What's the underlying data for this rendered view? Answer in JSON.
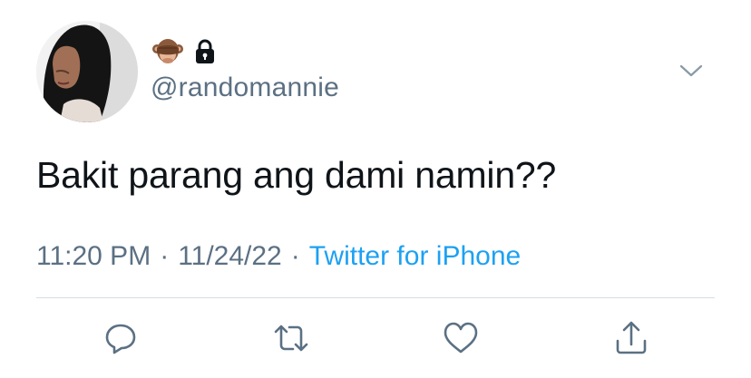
{
  "user": {
    "handle": "@randomannie",
    "name_emoji_icon": "see-no-evil-monkey-icon",
    "protected_icon": "lock-icon"
  },
  "tweet": {
    "text": "Bakit parang ang dami namin??",
    "time": "11:20 PM",
    "date": "11/24/22",
    "separator": "·",
    "source": "Twitter for iPhone"
  },
  "actions": {
    "icons": [
      "reply-icon",
      "retweet-icon",
      "like-icon",
      "share-icon"
    ]
  },
  "colors": {
    "text": "#0f1419",
    "secondary": "#5b7083",
    "accent": "#1da1f2",
    "divider": "#d6dde3"
  }
}
